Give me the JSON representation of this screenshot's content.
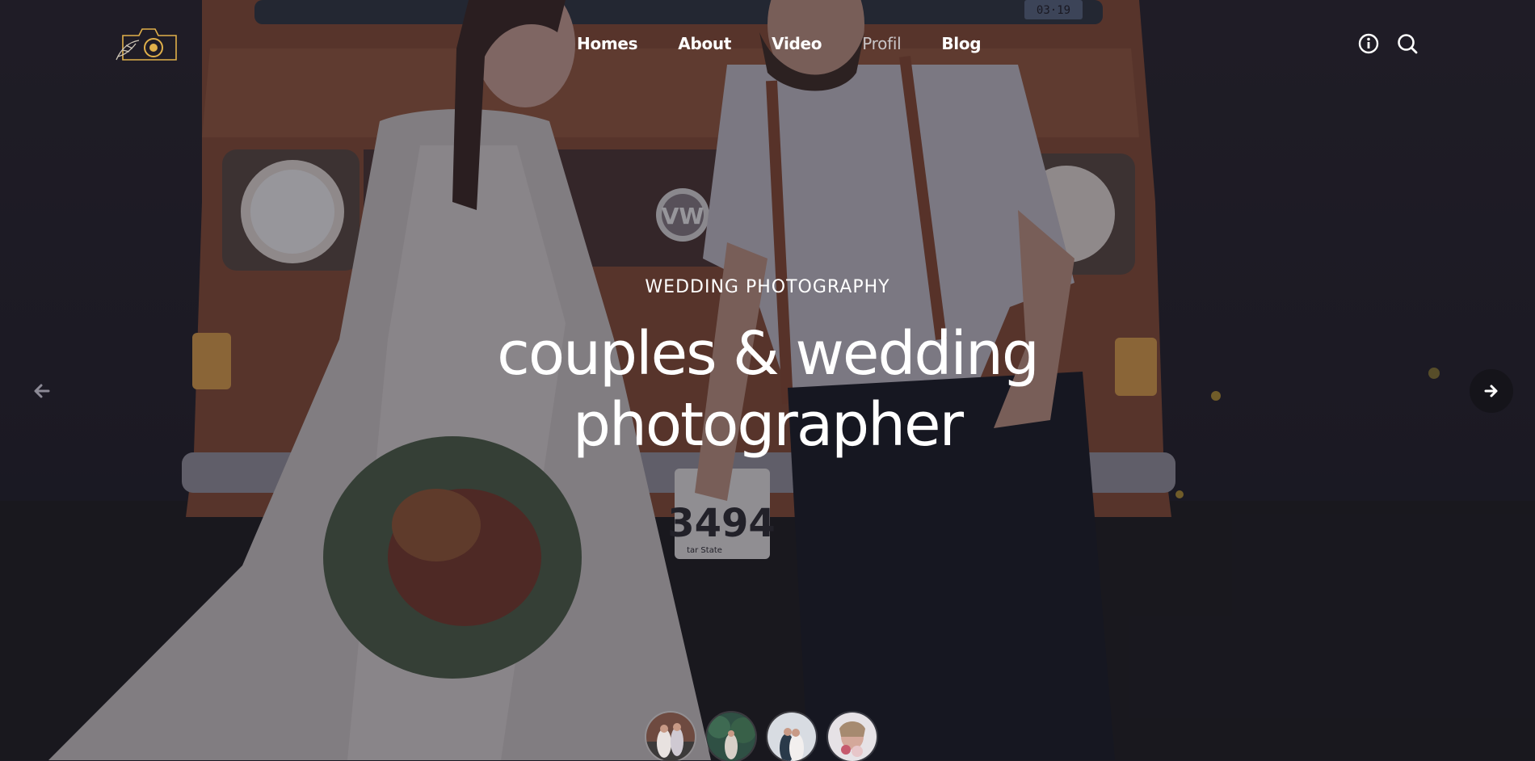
{
  "header": {
    "logo": "camera-logo",
    "nav": [
      {
        "label": "Homes"
      },
      {
        "label": "About"
      },
      {
        "label": "Video"
      },
      {
        "label": "Profil"
      },
      {
        "label": "Blog"
      }
    ],
    "icons": [
      "info-icon",
      "search-icon"
    ]
  },
  "hero": {
    "eyebrow": "WEDDING PHOTOGRAPHY",
    "headline_line1": "couples & wedding",
    "headline_line2": "photographer",
    "van_plate": "3494",
    "van_plate_small": "tar State",
    "top_plate": "03·19"
  },
  "slider": {
    "prev_icon": "arrow-left-icon",
    "next_icon": "arrow-right-icon",
    "thumbnails": 4
  },
  "colors": {
    "accent_gold": "#e0b04a",
    "overlay": "#181622",
    "van": "#8a4e34"
  }
}
